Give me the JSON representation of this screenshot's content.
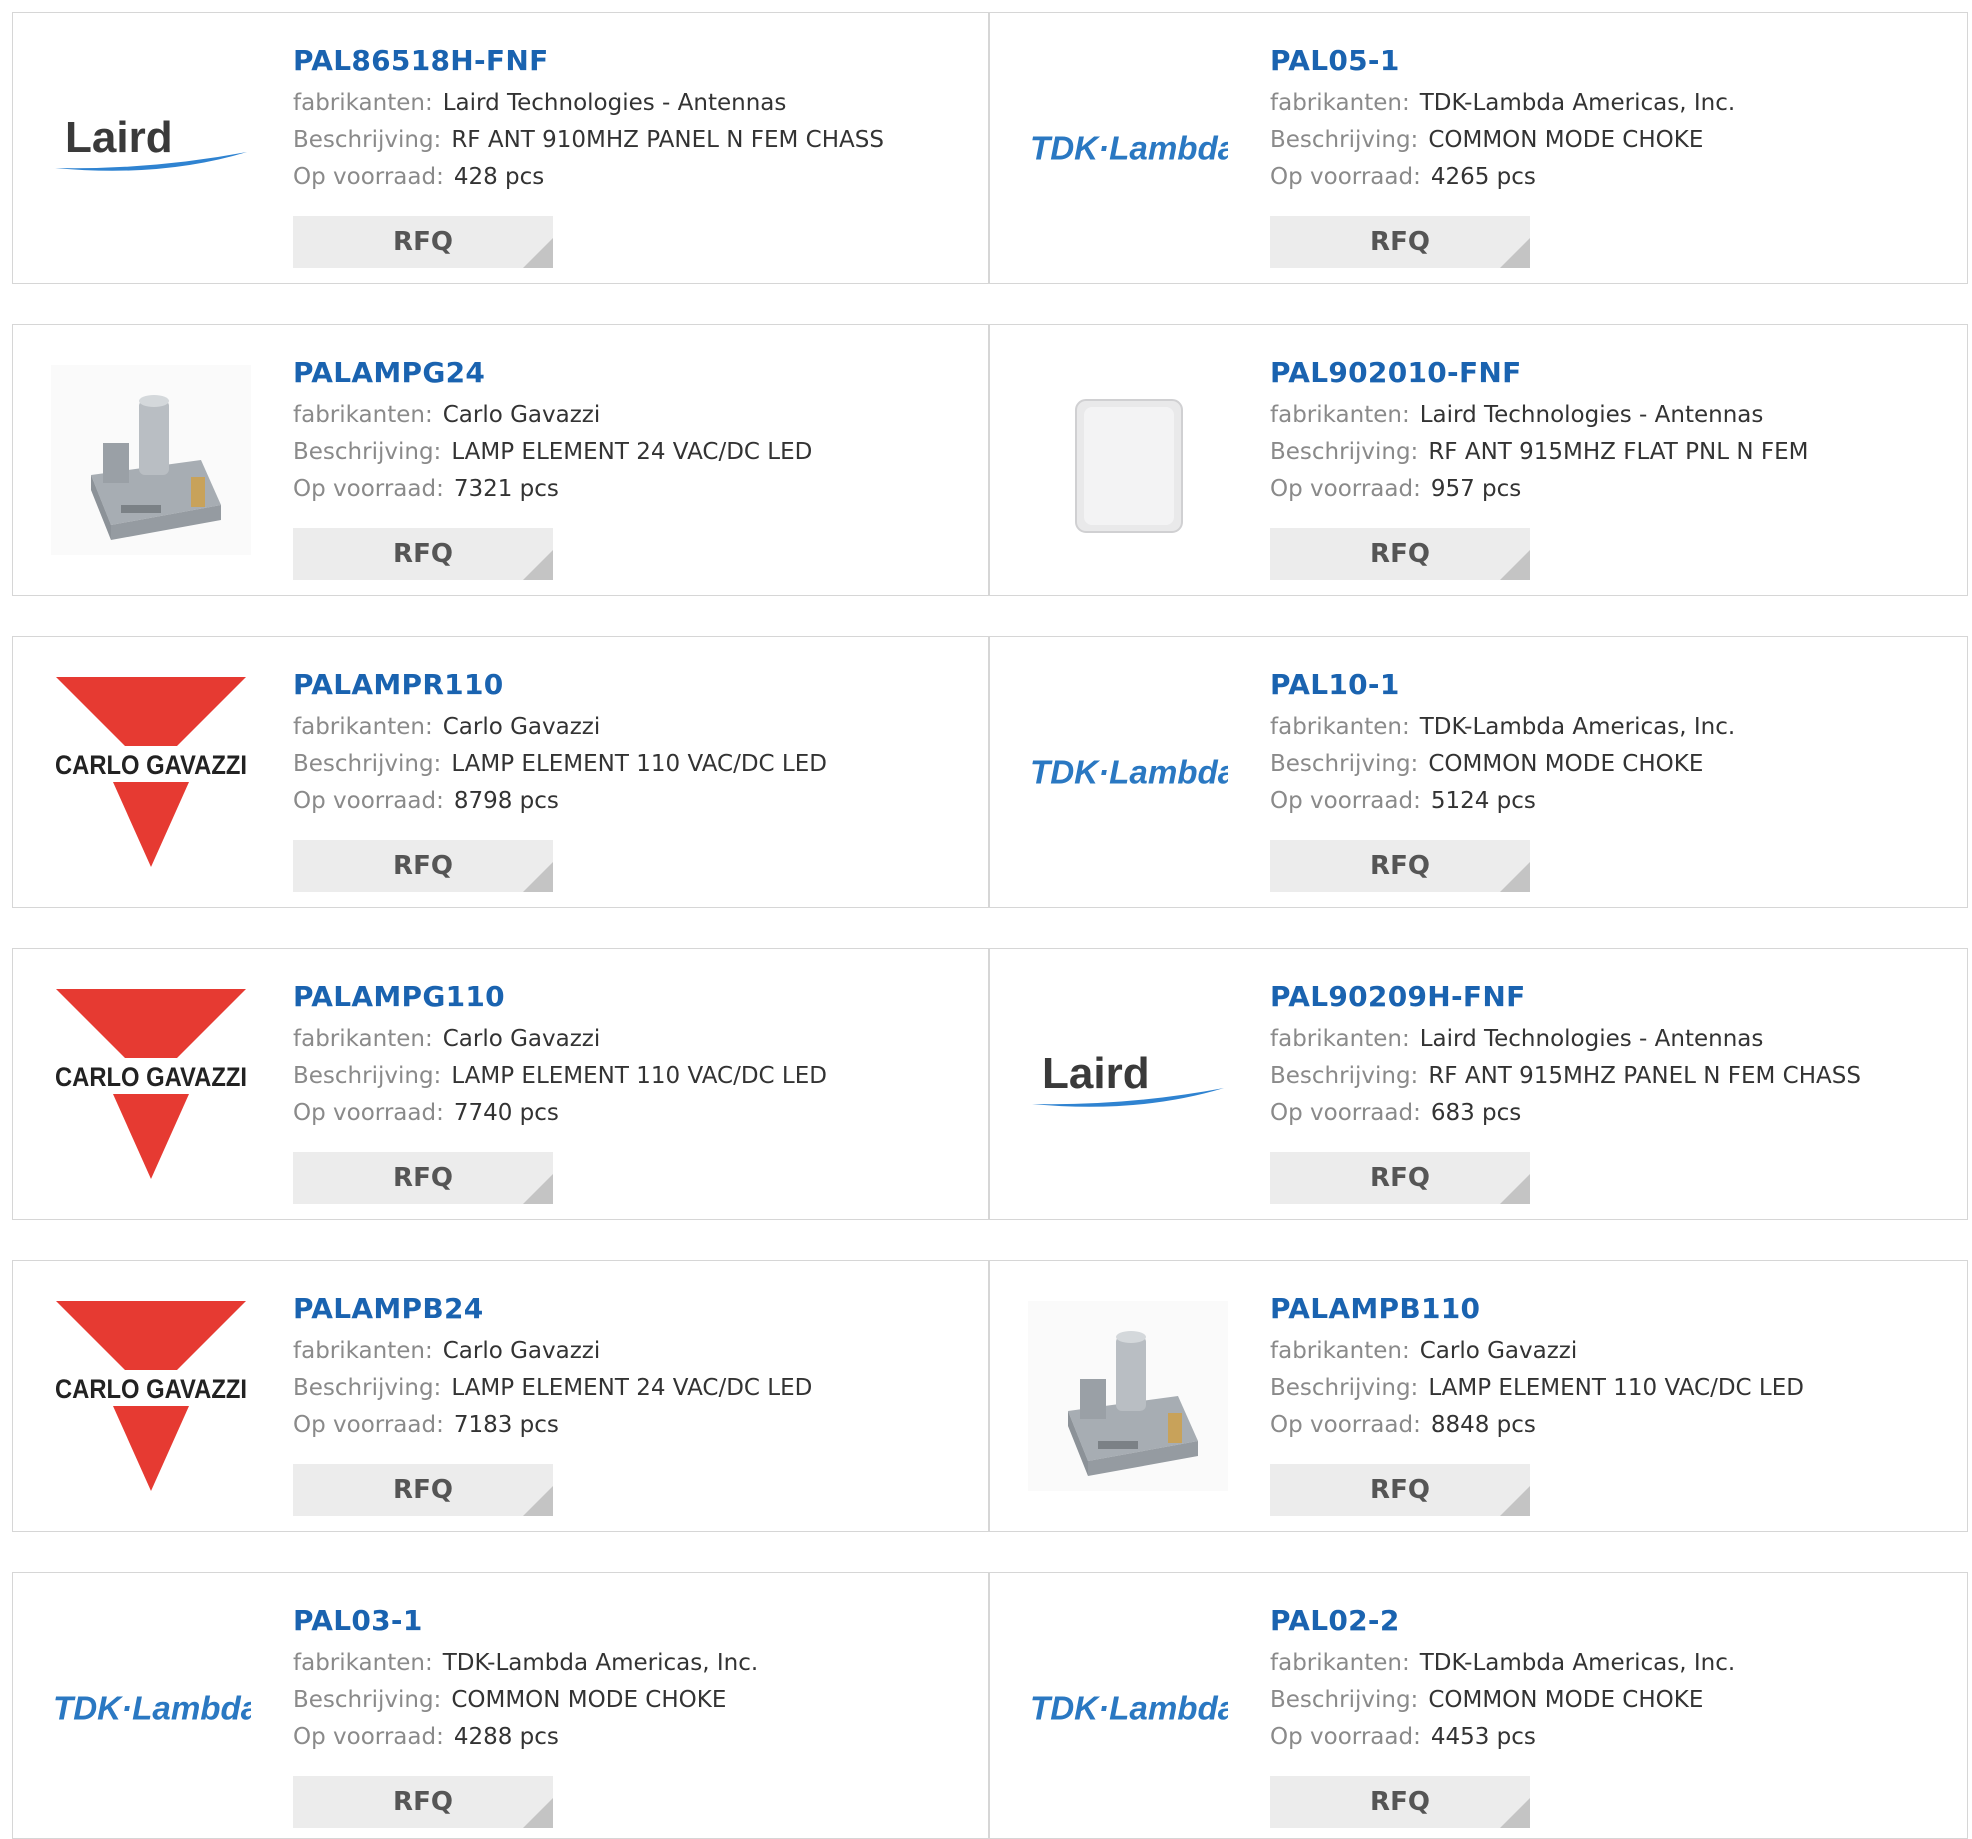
{
  "labels": {
    "manufacturer": "fabrikanten:",
    "description": "Beschrijving:",
    "stock": "Op voorraad:"
  },
  "rfq_label": "RFQ",
  "colors": {
    "link": "#1a63b0",
    "gavazzi_red": "#e63a32",
    "tdk_blue": "#2a78c2"
  },
  "products": [
    {
      "pn": "PAL86518H-FNF",
      "manufacturer": "Laird Technologies - Antennas",
      "description": "RF ANT 910MHZ PANEL N FEM CHASS",
      "stock": "428 pcs",
      "logo": "laird-logo",
      "logo_text": "Laird"
    },
    {
      "pn": "PAL05-1",
      "manufacturer": "TDK-Lambda Americas, Inc.",
      "description": "COMMON MODE CHOKE",
      "stock": "4265 pcs",
      "logo": "tdk-lambda-logo",
      "logo_text": "TDK·Lambda"
    },
    {
      "pn": "PALAMPG24",
      "manufacturer": "Carlo Gavazzi",
      "description": "LAMP ELEMENT 24 VAC/DC LED",
      "stock": "7321 pcs",
      "logo": "lamp-element-photo"
    },
    {
      "pn": "PAL902010-FNF",
      "manufacturer": "Laird Technologies - Antennas",
      "description": "RF ANT 915MHZ FLAT PNL N FEM",
      "stock": "957 pcs",
      "logo": "flat-panel-antenna-photo"
    },
    {
      "pn": "PALAMPR110",
      "manufacturer": "Carlo Gavazzi",
      "description": "LAMP ELEMENT 110 VAC/DC LED",
      "stock": "8798 pcs",
      "logo": "carlo-gavazzi-logo",
      "logo_text": "CARLO GAVAZZI"
    },
    {
      "pn": "PAL10-1",
      "manufacturer": "TDK-Lambda Americas, Inc.",
      "description": "COMMON MODE CHOKE",
      "stock": "5124 pcs",
      "logo": "tdk-lambda-logo",
      "logo_text": "TDK·Lambda"
    },
    {
      "pn": "PALAMPG110",
      "manufacturer": "Carlo Gavazzi",
      "description": "LAMP ELEMENT 110 VAC/DC LED",
      "stock": "7740 pcs",
      "logo": "carlo-gavazzi-logo",
      "logo_text": "CARLO GAVAZZI"
    },
    {
      "pn": "PAL90209H-FNF",
      "manufacturer": "Laird Technologies - Antennas",
      "description": "RF ANT 915MHZ PANEL N FEM CHASS",
      "stock": "683 pcs",
      "logo": "laird-logo",
      "logo_text": "Laird"
    },
    {
      "pn": "PALAMPB24",
      "manufacturer": "Carlo Gavazzi",
      "description": "LAMP ELEMENT 24 VAC/DC LED",
      "stock": "7183 pcs",
      "logo": "carlo-gavazzi-logo",
      "logo_text": "CARLO GAVAZZI"
    },
    {
      "pn": "PALAMPB110",
      "manufacturer": "Carlo Gavazzi",
      "description": "LAMP ELEMENT 110 VAC/DC LED",
      "stock": "8848 pcs",
      "logo": "lamp-element-photo"
    },
    {
      "pn": "PAL03-1",
      "manufacturer": "TDK-Lambda Americas, Inc.",
      "description": "COMMON MODE CHOKE",
      "stock": "4288 pcs",
      "logo": "tdk-lambda-logo",
      "logo_text": "TDK·Lambda"
    },
    {
      "pn": "PAL02-2",
      "manufacturer": "TDK-Lambda Americas, Inc.",
      "description": "COMMON MODE CHOKE",
      "stock": "4453 pcs",
      "logo": "tdk-lambda-logo",
      "logo_text": "TDK·Lambda"
    }
  ]
}
